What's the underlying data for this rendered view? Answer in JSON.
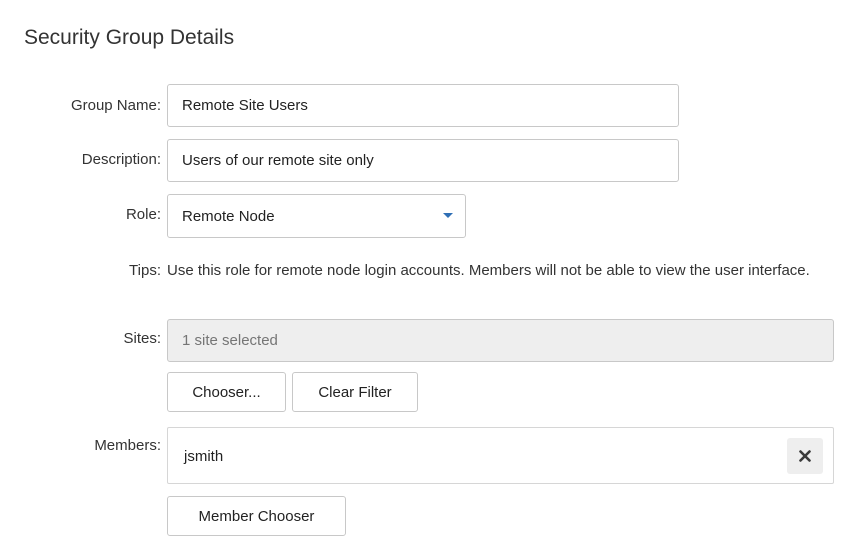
{
  "page": {
    "title": "Security Group Details"
  },
  "form": {
    "group_name": {
      "label": "Group Name:",
      "value": "Remote Site Users"
    },
    "description": {
      "label": "Description:",
      "value": "Users of our remote site only"
    },
    "role": {
      "label": "Role:",
      "selected": "Remote Node"
    },
    "tips": {
      "label": "Tips:",
      "text": "Use this role for remote node login accounts. Members will not be able to view the user interface."
    },
    "sites": {
      "label": "Sites:",
      "placeholder": "1 site selected",
      "chooser_button": "Chooser...",
      "clear_filter_button": "Clear Filter"
    },
    "members": {
      "label": "Members:",
      "items": [
        {
          "name": "jsmith"
        }
      ],
      "chooser_button": "Member Chooser"
    }
  },
  "colors": {
    "caret": "#2f6fb5",
    "disabled_bg": "#eeeeee",
    "border": "#c8c8c8"
  },
  "icons": {
    "role_dropdown": "chevron-down-icon",
    "member_remove": "close-icon"
  }
}
